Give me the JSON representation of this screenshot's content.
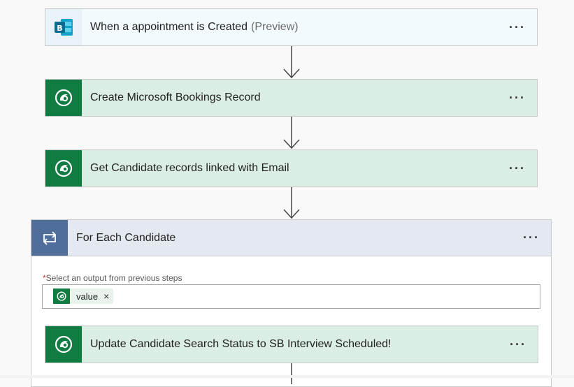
{
  "steps": [
    {
      "title": "When a appointment is Created",
      "suffix": "(Preview)",
      "icon": "bookings-icon",
      "menu": "···"
    },
    {
      "title": "Create Microsoft Bookings Record",
      "icon": "dataverse-icon",
      "menu": "···"
    },
    {
      "title": "Get Candidate records linked with Email",
      "icon": "dataverse-icon",
      "menu": "···"
    }
  ],
  "loop": {
    "title": "For Each Candidate",
    "icon": "loop-icon",
    "menu": "···",
    "field_required_marker": "*",
    "field_label": "Select an output from previous steps",
    "token": {
      "label": "value",
      "remove": "×",
      "icon": "dataverse-icon"
    },
    "inner_step": {
      "title": "Update Candidate Search Status to SB Interview Scheduled!",
      "icon": "dataverse-icon",
      "menu": "···"
    }
  },
  "colors": {
    "dataverse_green": "#107c41",
    "dataverse_bg": "#dbeee3",
    "loop_blue": "#4f6f9a",
    "loop_header_bg": "#e4e8f0",
    "required_red": "#d13438"
  }
}
